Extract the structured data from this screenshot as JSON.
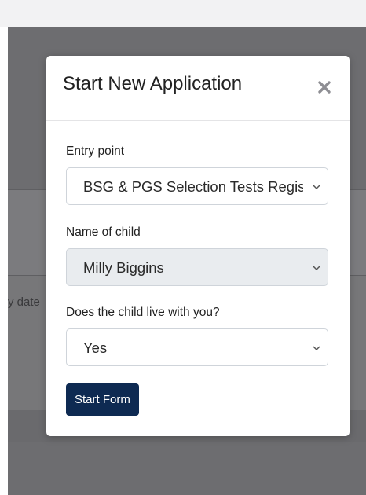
{
  "modal": {
    "title": "Start New Application",
    "close_glyph": "×",
    "close_icon": "close-icon",
    "chevron_icon": "chevron-down-icon"
  },
  "fields": {
    "entry_point": {
      "label": "Entry point",
      "value": "BSG & PGS Selection Tests Registration"
    },
    "child_name": {
      "label": "Name of child",
      "value": "Milly Biggins"
    },
    "lives_with": {
      "label": "Does the child live with you?",
      "value": "Yes"
    }
  },
  "actions": {
    "start_label": "Start Form"
  },
  "background": {
    "partial_text": "y date"
  },
  "colors": {
    "primary_button": "#0e2a52",
    "backdrop": "#6d6d70",
    "disabled_field": "#e9ecef"
  }
}
